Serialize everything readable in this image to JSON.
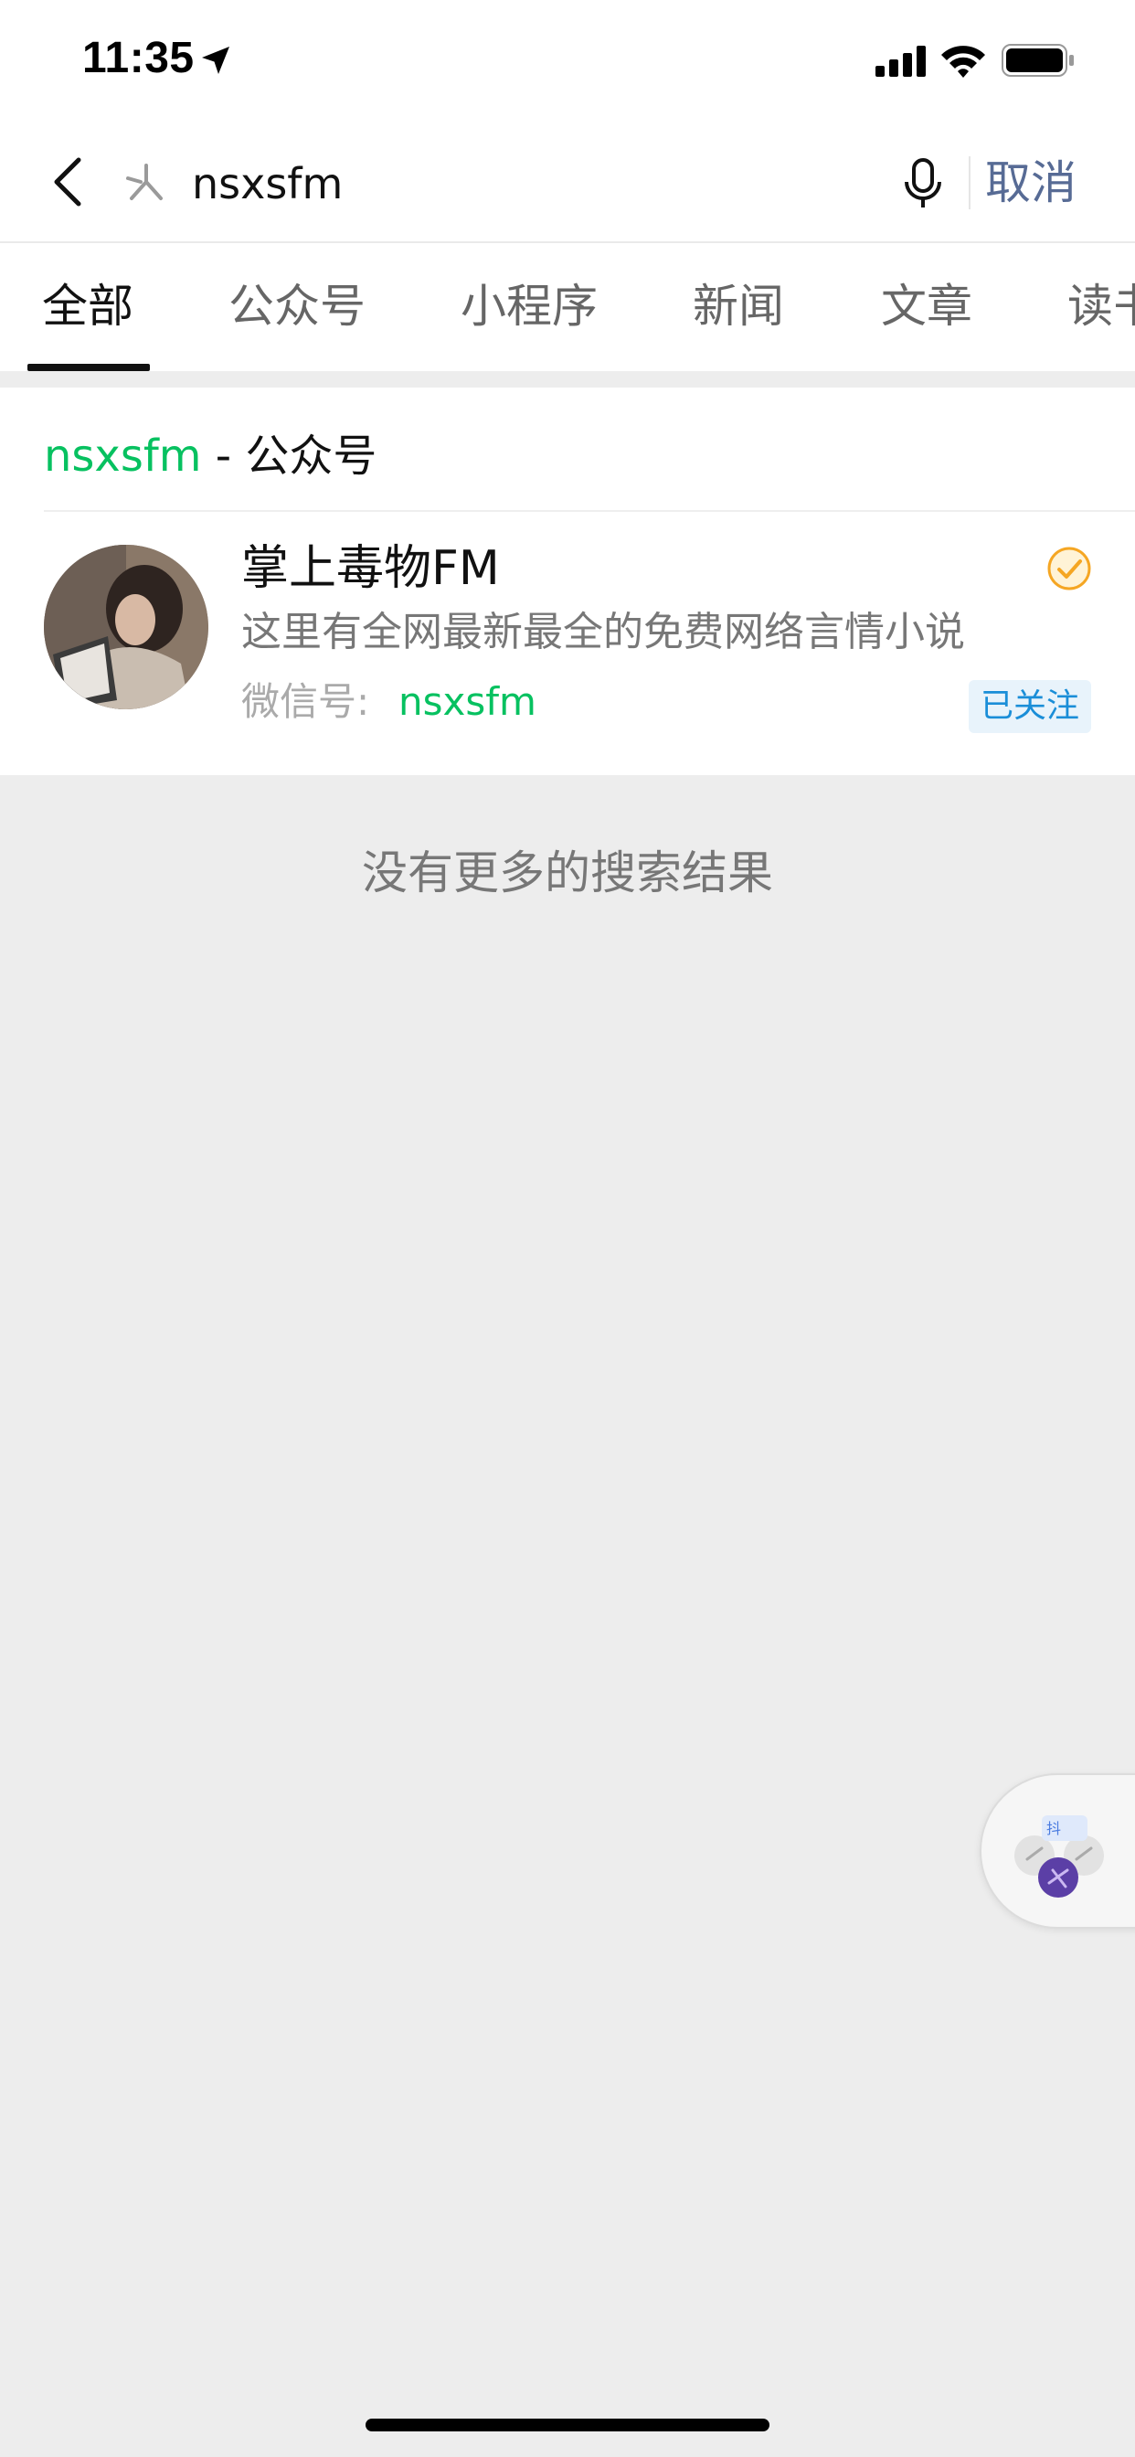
{
  "status_bar": {
    "time": "11:35",
    "icons": [
      "location-arrow-icon",
      "signal-icon",
      "wifi-icon",
      "battery-icon"
    ]
  },
  "search": {
    "query": "nsxsfm",
    "cancel_label": "取消",
    "icons": [
      "back-chevron-icon",
      "search-logo-icon",
      "microphone-icon"
    ]
  },
  "tabs": [
    {
      "label": "全部",
      "active": true
    },
    {
      "label": "公众号"
    },
    {
      "label": "小程序"
    },
    {
      "label": "新闻"
    },
    {
      "label": "文章"
    },
    {
      "label": "读书"
    }
  ],
  "results": {
    "section_keyword": "nsxsfm",
    "section_suffix": " - 公众号",
    "account": {
      "name": "掌上毒物FM",
      "description": "这里有全网最新最全的免费网络言情小说",
      "wechat_id_label": "微信号:",
      "wechat_id": "nsxsfm",
      "followed_label": "已关注",
      "verified_icon": "verified-badge-icon",
      "avatar_icon": "account-avatar-image"
    }
  },
  "footer": {
    "no_more": "没有更多的搜索结果"
  },
  "colors": {
    "accent_green": "#07c160",
    "link_blue": "#576b95",
    "badge_blue": "#1a8ed8",
    "background": "#ededed",
    "verified_orange": "#f5a623"
  }
}
